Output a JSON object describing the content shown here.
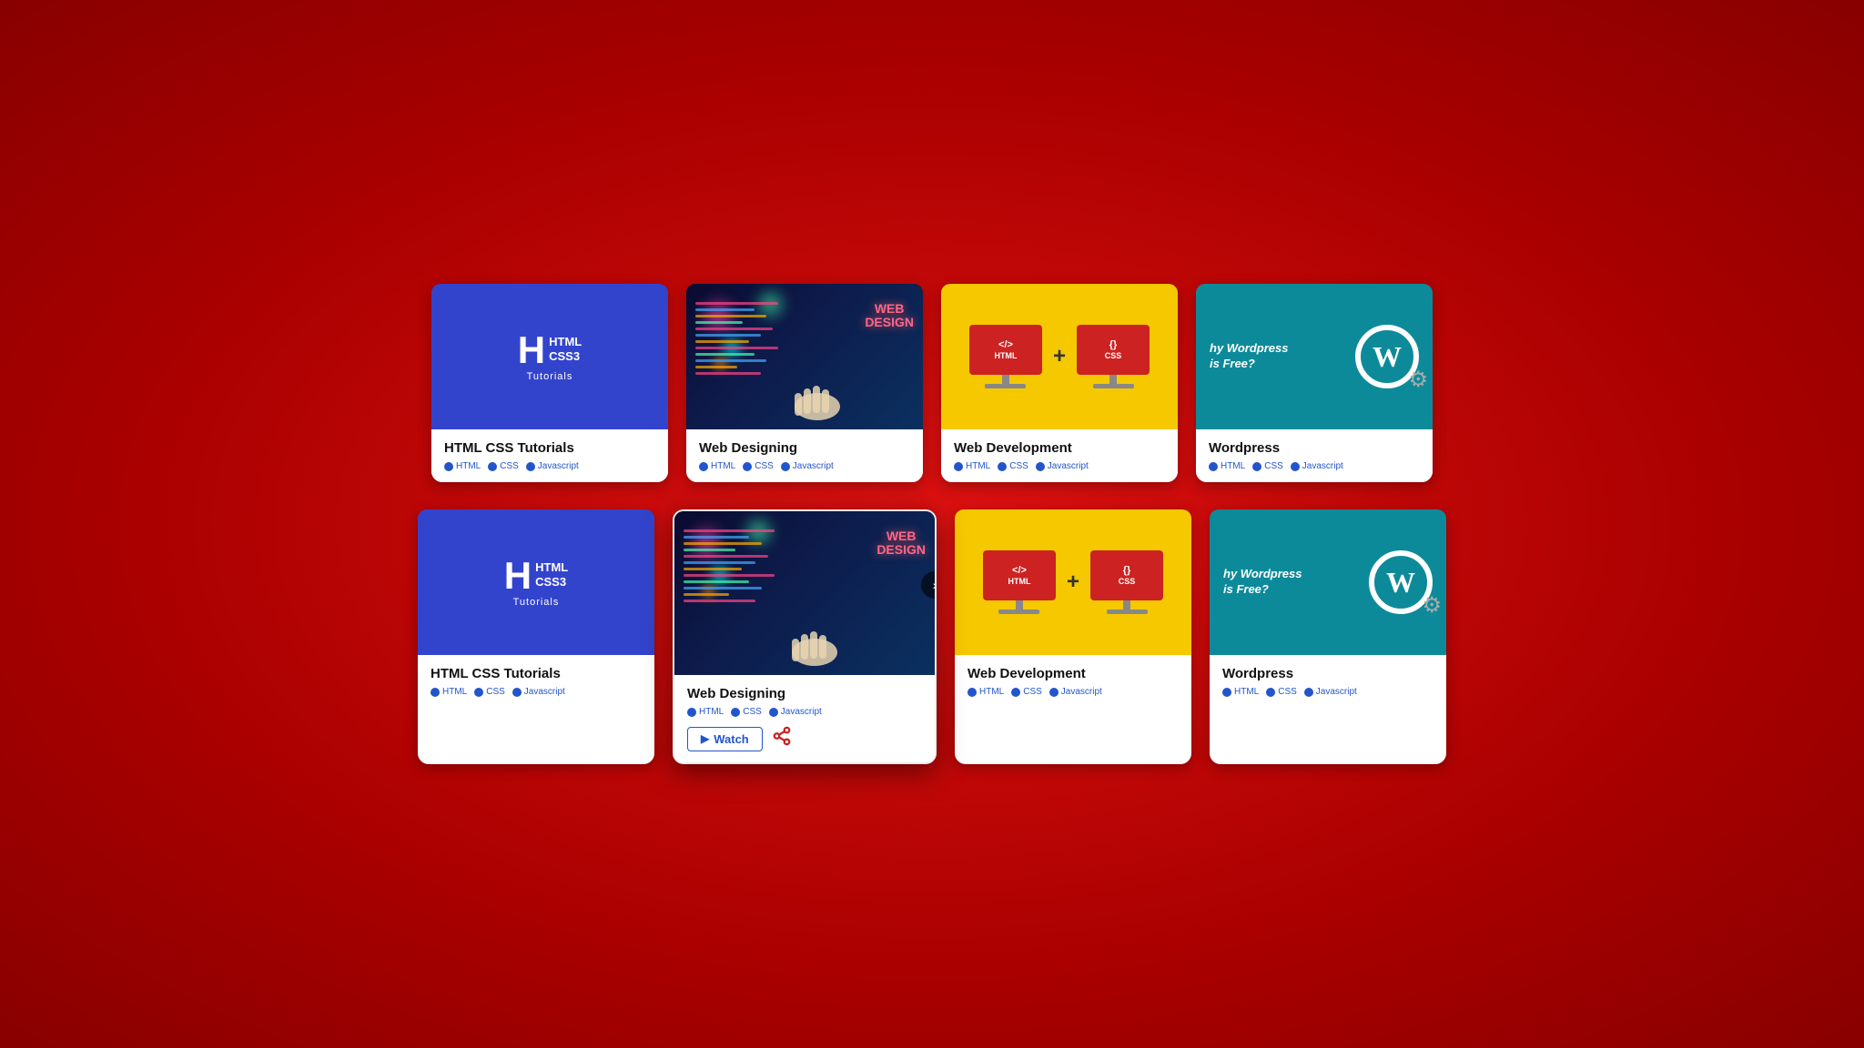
{
  "background": "#cc0000",
  "rows": [
    {
      "id": "row1",
      "cards": [
        {
          "id": "card-html-css-1",
          "type": "html-css",
          "title": "HTML CSS Tutorials",
          "tags": [
            "HTML",
            "CSS",
            "Javascript"
          ],
          "expanded": false
        },
        {
          "id": "card-web-design-1",
          "type": "web-design",
          "title": "Web Designing",
          "tags": [
            "HTML",
            "CSS",
            "Javascript"
          ],
          "expanded": false
        },
        {
          "id": "card-web-dev-1",
          "type": "web-dev",
          "title": "Web Development",
          "tags": [
            "HTML",
            "CSS",
            "Javascript"
          ],
          "expanded": false
        },
        {
          "id": "card-wordpress-1",
          "type": "wordpress",
          "title": "Wordpress",
          "tags": [
            "HTML",
            "CSS",
            "Javascript"
          ],
          "expanded": false
        }
      ]
    },
    {
      "id": "row2",
      "cards": [
        {
          "id": "card-html-css-2",
          "type": "html-css",
          "title": "HTML CSS Tutorials",
          "tags": [
            "HTML",
            "CSS",
            "Javascript"
          ],
          "expanded": false
        },
        {
          "id": "card-web-design-2",
          "type": "web-design",
          "title": "Web Designing",
          "tags": [
            "HTML",
            "CSS",
            "Javascript"
          ],
          "expanded": true,
          "watch_label": "Watch",
          "nav_arrow": "›"
        },
        {
          "id": "card-web-dev-2",
          "type": "web-dev",
          "title": "Web Development",
          "tags": [
            "HTML",
            "CSS",
            "Javascript"
          ],
          "expanded": false
        },
        {
          "id": "card-wordpress-2",
          "type": "wordpress",
          "title": "Wordpress",
          "tags": [
            "HTML",
            "CSS",
            "Javascript"
          ],
          "expanded": false
        }
      ]
    }
  ],
  "labels": {
    "html": "HTML",
    "css": "CSS",
    "javascript": "Javascript",
    "watch": "Watch",
    "logo_html": "HTML",
    "logo_css3": "CSS3",
    "logo_tutorials": "Tutorials",
    "web_design_line1": "WEB",
    "web_design_line2": "DESIGN",
    "why_wordpress": "hy Wordpress is Free?"
  }
}
